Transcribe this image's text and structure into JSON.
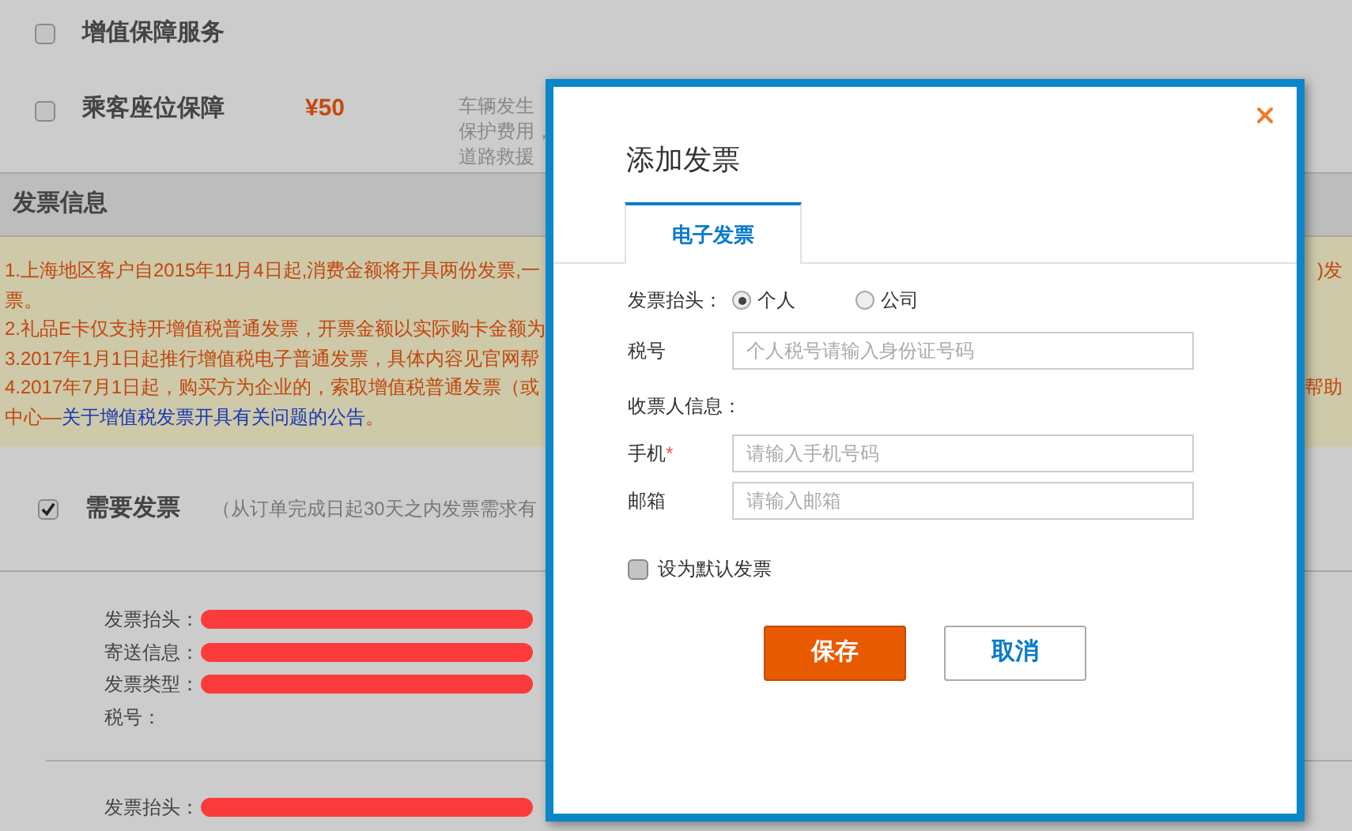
{
  "services": [
    {
      "label": "增值保障服务",
      "checked": false
    },
    {
      "label": "乘客座位保障",
      "checked": false,
      "price": "¥50",
      "description": [
        "车辆发生",
        "保护费用，",
        "道路救援"
      ]
    }
  ],
  "invoice_section": {
    "title": "发票信息",
    "notices": [
      {
        "text": "1.上海地区客户自2015年11月4日起,消费金额将开具两份发票,一",
        "right": ")发"
      },
      {
        "text": "票。"
      },
      {
        "text": "2.礼品E卡仅支持开增值税普通发票，开票金额以实际购卡金额为"
      },
      {
        "text": "3.2017年1月1日起推行增值税电子普通发票，具体内容见官网帮"
      },
      {
        "text": "4.2017年7月1日起，购买方为企业的，索取增值税普通发票（或",
        "right": "帮助"
      },
      {
        "text": "中心—",
        "link": "关于增值税发票开具有关问题的公告",
        "after": "。"
      }
    ],
    "need_invoice": {
      "label": "需要发票",
      "checked": true,
      "note": "（从订单完成日起30天之内发票需求有"
    },
    "details": [
      {
        "fields": [
          {
            "label": "发票抬头：",
            "redacted": true
          },
          {
            "label": "寄送信息：",
            "redacted": true
          },
          {
            "label": "发票类型：",
            "redacted": true
          },
          {
            "label": "税号：",
            "redacted": false
          }
        ]
      },
      {
        "fields": [
          {
            "label": "发票抬头：",
            "redacted": true
          }
        ]
      }
    ]
  },
  "dialog": {
    "title": "添加发票",
    "tabs": [
      {
        "label": "电子发票",
        "selected": true
      }
    ],
    "title_choice": {
      "label": "发票抬头：",
      "options": [
        {
          "label": "个人",
          "selected": true
        },
        {
          "label": "公司",
          "selected": false
        }
      ]
    },
    "tax_field": {
      "label": "税号",
      "placeholder": "个人税号请输入身份证号码"
    },
    "recipient_heading": "收票人信息：",
    "recipient_fields": [
      {
        "label": "手机",
        "required_mark": "*",
        "placeholder": "请输入手机号码"
      },
      {
        "label": "邮箱",
        "placeholder": "请输入邮箱"
      }
    ],
    "default_checkbox": {
      "label": "设为默认发票",
      "checked": false
    },
    "buttons": [
      {
        "label": "保存",
        "kind": "primary"
      },
      {
        "label": "取消",
        "kind": "secondary"
      }
    ]
  }
}
